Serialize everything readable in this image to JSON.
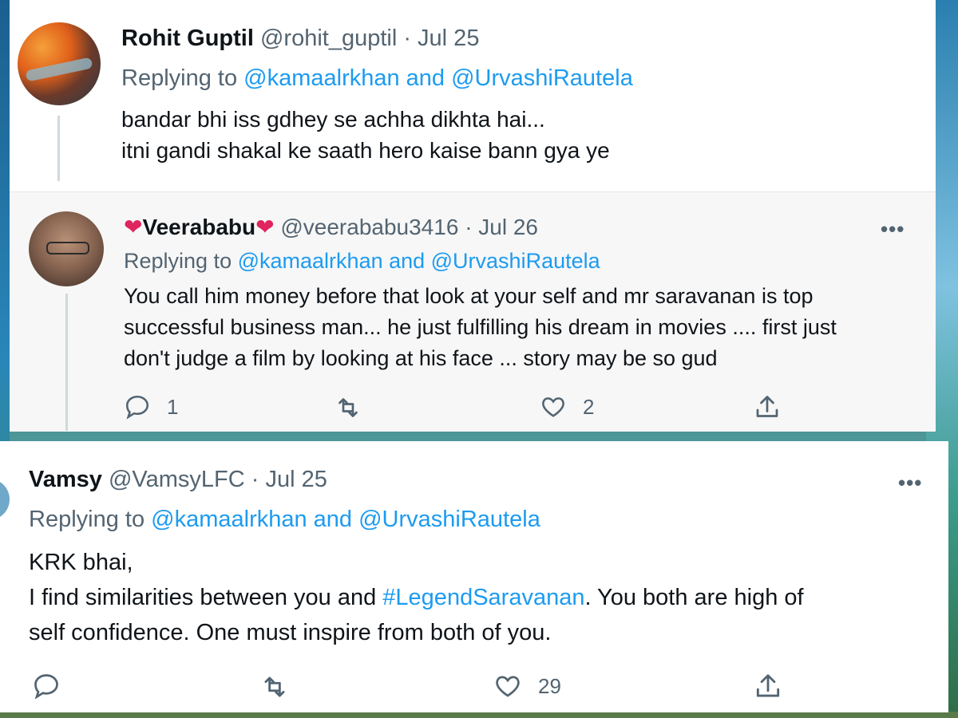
{
  "tweets": [
    {
      "name": "Rohit Guptil",
      "handle": "@rohit_guptil",
      "date": "· Jul 25",
      "replying_prefix": "Replying to",
      "replying_to": "@kamaalrkhan and @UrvashiRautela",
      "lines": [
        "bandar bhi iss gdhey se achha dikhta hai...",
        "itni gandi shakal ke saath hero kaise bann gya ye"
      ]
    },
    {
      "name": "Veerababu",
      "name_emoji": "❤",
      "handle": "@veerababu3416",
      "date": "· Jul 26",
      "replying_prefix": "Replying to",
      "replying_to": "@kamaalrkhan and @UrvashiRautela",
      "lines": [
        "You call him money before that look at your self and mr saravanan is top",
        "successful business man... he just fulfilling his dream in movies .... first just",
        "don't judge a film by looking at his face ... story may be so gud"
      ],
      "more": "•••",
      "reply_count": "1",
      "like_count": "2"
    },
    {
      "name": "Vamsy",
      "handle": "@VamsyLFC",
      "date": "· Jul 25",
      "replying_prefix": "Replying to",
      "replying_to": "@kamaalrkhan and @UrvashiRautela",
      "line1": "KRK bhai,",
      "line2_pre": "I find similarities between you and ",
      "hashtag": "#LegendSaravanan",
      "line2_post": ". You both are high of",
      "line3": "self confidence. One must inspire from both of you.",
      "more": "•••",
      "like_count": "29"
    }
  ],
  "icons": {
    "reply": "reply-icon",
    "retweet": "retweet-icon",
    "like": "heart-icon",
    "share": "share-icon"
  },
  "colors": {
    "link": "#1d9bf0",
    "muted": "#536471",
    "text": "#0f1419",
    "heart": "#e0245e"
  }
}
